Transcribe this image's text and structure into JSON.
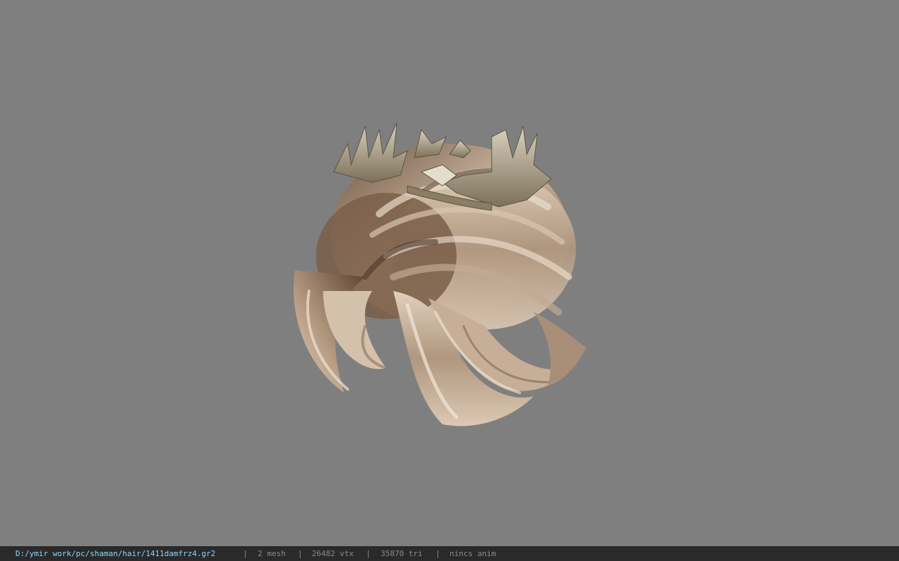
{
  "viewer": {
    "background_color": "#7f7f7f",
    "model_description_icon": "hair-model-with-crown"
  },
  "statusbar": {
    "file_path": "D:/ymir work/pc/shaman/hair/1411damfrz4.gr2",
    "separator": "|",
    "mesh_count": "2 mesh",
    "vertex_count": "26482 vtx",
    "triangle_count": "35870 tri",
    "anim_status": "nincs anim",
    "path_color": "#8fd4ff",
    "text_color": "#8a8a8a"
  }
}
